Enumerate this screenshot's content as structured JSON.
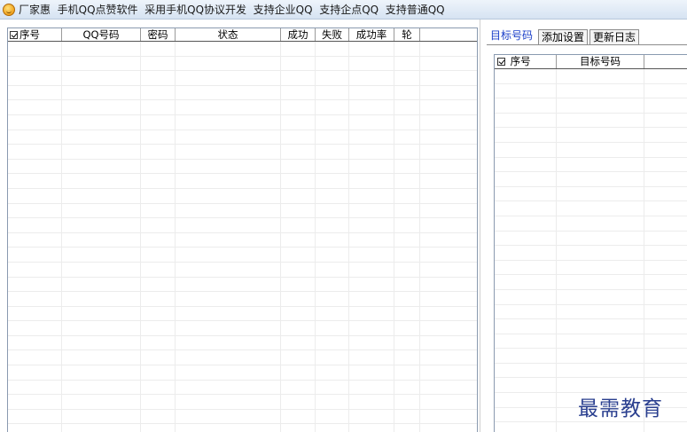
{
  "window": {
    "title": "厂家惠  手机QQ点赞软件  采用手机QQ协议开发  支持企业QQ  支持企点QQ  支持普通QQ"
  },
  "account_grid": {
    "select_all_checked": true,
    "columns": [
      "序号",
      "QQ号码",
      "密码",
      "状态",
      "成功",
      "失败",
      "成功率",
      "轮"
    ],
    "rows": []
  },
  "tabs": [
    {
      "label": "目标号码",
      "active": true
    },
    {
      "label": "添加设置",
      "active": false
    },
    {
      "label": "更新日志",
      "active": false
    }
  ],
  "target_grid": {
    "select_all_checked": true,
    "columns": [
      "序号",
      "目标号码"
    ],
    "rows": []
  },
  "watermark": "最需教育",
  "colors": {
    "titlebar_top": "#eef4fb",
    "titlebar_bottom": "#d6e3f2",
    "active_tab_text": "#1a3ec8",
    "watermark": "#2a3f8f"
  },
  "icons": {
    "app": "smiley-coin-icon",
    "checkbox": "checkbox-checked-icon"
  }
}
